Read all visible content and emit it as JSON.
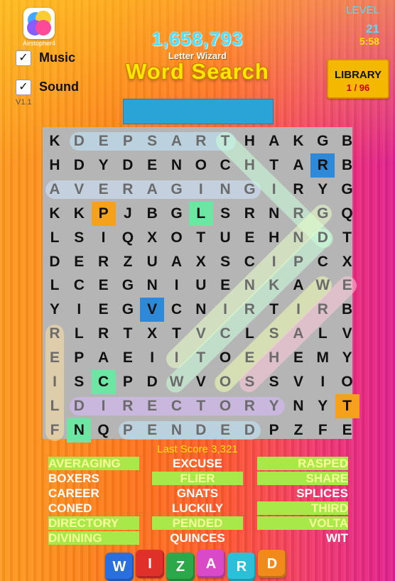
{
  "header": {
    "user_name": "Airstopher4",
    "score": "1,658,793",
    "subtitle": "Letter Wizard",
    "title": "Word Search",
    "version": "V1.1",
    "level_label": "LEVEL",
    "level_number": "21",
    "timer": "5:58"
  },
  "settings": {
    "music_label": "Music",
    "music_checked": "✓",
    "sound_label": "Sound",
    "sound_checked": "✓"
  },
  "library": {
    "label": "LIBRARY",
    "count": "1 / 96"
  },
  "grid": {
    "rows": [
      "KDEPSARTHAKGB",
      "HDYDENOCHTARB",
      "AVERAGINGIRYG",
      "KKPJBGLSRNRGQ",
      "LSIQXOTUEHNDT",
      "DERZUAXSCIPCX",
      "LCEGNIUENKAWE",
      "YIEGVCNIRTIRB",
      "RLRTXTVCLSALV",
      "EPAEIITOEHEMY",
      "ISCPDWVOSSVIO",
      "LDIRECTORYNYT",
      "FNQPENDEDPZFE"
    ],
    "found": [
      {
        "word": "DEPSART",
        "row": 0,
        "col": 1,
        "dr": 0,
        "dc": 1,
        "len": 7,
        "color": "#bfe9ff"
      },
      {
        "word": "AVERAGING",
        "row": 2,
        "col": 0,
        "dr": 0,
        "dc": 1,
        "len": 9,
        "color": "#cfe6ff"
      },
      {
        "word": "DIRECTORY",
        "row": 11,
        "col": 1,
        "dr": 0,
        "dc": 1,
        "len": 9,
        "color": "#d9b8ff"
      },
      {
        "word": "PENDED",
        "row": 12,
        "col": 3,
        "dr": 0,
        "dc": 1,
        "len": 6,
        "color": "#bfe9ff"
      },
      {
        "word": "REILF",
        "row": 8,
        "col": 0,
        "dr": 1,
        "dc": 0,
        "len": 5,
        "color": "#ffe0a0"
      },
      {
        "word": "THIRD",
        "row": 0,
        "col": 7,
        "dr": 1,
        "dc": 1,
        "len": 5,
        "color": "#c9ffd9"
      },
      {
        "word": "DNRIGNI",
        "row": 4,
        "col": 11,
        "dr": 1,
        "dc": -1,
        "len": 7,
        "color": "#c9ffd9"
      },
      {
        "word": "GNRIVID",
        "row": 3,
        "col": 11,
        "dr": 1,
        "dc": -1,
        "len": 7,
        "color": "#e8ffc8"
      },
      {
        "word": "WALVO",
        "row": 6,
        "col": 11,
        "dr": 1,
        "dc": -1,
        "len": 5,
        "color": "#f0ffb0"
      },
      {
        "word": "ERHSS",
        "row": 6,
        "col": 12,
        "dr": 1,
        "dc": -1,
        "len": 5,
        "color": "#ffc8dc"
      }
    ],
    "marked_cells": [
      {
        "row": 1,
        "col": 11,
        "color": "blue"
      },
      {
        "row": 3,
        "col": 2,
        "color": "orange"
      },
      {
        "row": 3,
        "col": 6,
        "color": "green"
      },
      {
        "row": 7,
        "col": 4,
        "color": "blue"
      },
      {
        "row": 10,
        "col": 2,
        "color": "green"
      },
      {
        "row": 11,
        "col": 12,
        "color": "orange"
      },
      {
        "row": 12,
        "col": 1,
        "color": "green"
      }
    ]
  },
  "last_score": "Last Score 3,321",
  "word_list": {
    "col1": [
      {
        "text": "AVERAGING",
        "found": true
      },
      {
        "text": "BOXERS",
        "found": false
      },
      {
        "text": "CAREER",
        "found": false
      },
      {
        "text": "CONED",
        "found": false
      },
      {
        "text": "DIRECTORY",
        "found": true
      },
      {
        "text": "DIVINING",
        "found": true
      }
    ],
    "col2": [
      {
        "text": "EXCUSE",
        "found": false
      },
      {
        "text": "FLIER",
        "found": true
      },
      {
        "text": "GNATS",
        "found": false
      },
      {
        "text": "LUCKILY",
        "found": false
      },
      {
        "text": "PENDED",
        "found": true
      },
      {
        "text": "QUINCES",
        "found": false
      }
    ],
    "col3": [
      {
        "text": "RASPED",
        "found": true
      },
      {
        "text": "SHARE",
        "found": true
      },
      {
        "text": "SPLICES",
        "found": false
      },
      {
        "text": "THIRD",
        "found": true
      },
      {
        "text": "VOLTA",
        "found": true
      },
      {
        "text": "WIT",
        "found": false
      }
    ]
  },
  "logo_tiles": [
    {
      "letter": "W",
      "color": "#2a6fe0"
    },
    {
      "letter": "I",
      "color": "#e0302a"
    },
    {
      "letter": "Z",
      "color": "#2aa84a"
    },
    {
      "letter": "A",
      "color": "#d84ac8"
    },
    {
      "letter": "R",
      "color": "#2ac0d8"
    },
    {
      "letter": "D",
      "color": "#f08a1a"
    }
  ]
}
